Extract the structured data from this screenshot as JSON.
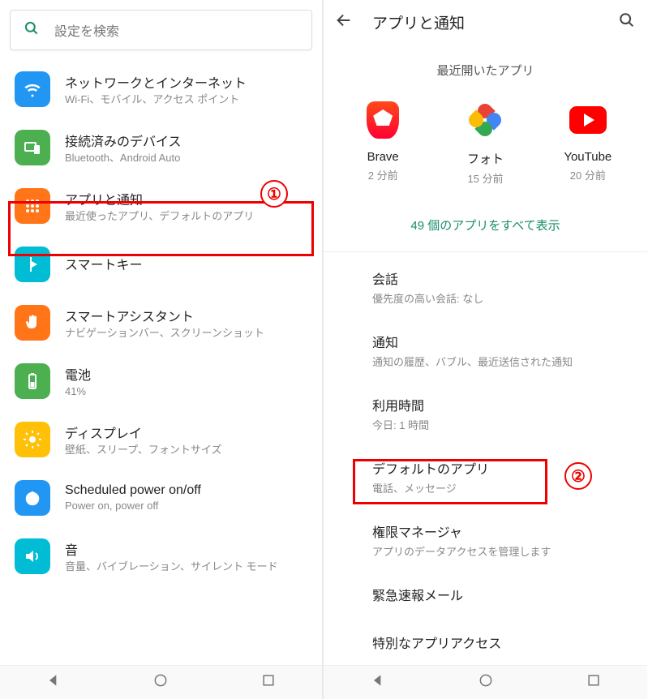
{
  "left": {
    "search_placeholder": "設定を検索",
    "items": [
      {
        "icon": "wifi",
        "color": "ic-blue",
        "title": "ネットワークとインターネット",
        "sub": "Wi-Fi、モバイル、アクセス ポイント"
      },
      {
        "icon": "devices",
        "color": "ic-green",
        "title": "接続済みのデバイス",
        "sub": "Bluetooth、Android Auto"
      },
      {
        "icon": "apps",
        "color": "ic-orange",
        "title": "アプリと通知",
        "sub": "最近使ったアプリ、デフォルトのアプリ"
      },
      {
        "icon": "smartkey",
        "color": "ic-teal",
        "title": "スマートキー",
        "sub": ""
      },
      {
        "icon": "hand",
        "color": "ic-orange2",
        "title": "スマートアシスタント",
        "sub": "ナビゲーションバー、スクリーンショット"
      },
      {
        "icon": "battery",
        "color": "ic-greenbat",
        "title": "電池",
        "sub": "41%"
      },
      {
        "icon": "display",
        "color": "ic-yellow",
        "title": "ディスプレイ",
        "sub": "壁紙、スリープ、フォントサイズ"
      },
      {
        "icon": "power",
        "color": "ic-blue2",
        "title": "Scheduled power on/off",
        "sub": "Power on, power off"
      },
      {
        "icon": "sound",
        "color": "ic-teal2",
        "title": "音",
        "sub": "音量、バイブレーション、サイレント モード"
      }
    ],
    "badge1": "①"
  },
  "right": {
    "title": "アプリと通知",
    "recent_heading": "最近開いたアプリ",
    "recent": [
      {
        "name": "Brave",
        "time": "2 分前"
      },
      {
        "name": "フォト",
        "time": "15 分前"
      },
      {
        "name": "YouTube",
        "time": "20 分前"
      }
    ],
    "show_all": "49 個のアプリをすべて表示",
    "details": [
      {
        "title": "会話",
        "sub": "優先度の高い会話: なし"
      },
      {
        "title": "通知",
        "sub": "通知の履歴、バブル、最近送信された通知"
      },
      {
        "title": "利用時間",
        "sub": "今日: 1 時間"
      },
      {
        "title": "デフォルトのアプリ",
        "sub": "電話、メッセージ"
      },
      {
        "title": "権限マネージャ",
        "sub": "アプリのデータアクセスを管理します"
      },
      {
        "title": "緊急速報メール",
        "sub": ""
      },
      {
        "title": "特別なアプリアクセス",
        "sub": ""
      }
    ],
    "badge2": "②"
  }
}
